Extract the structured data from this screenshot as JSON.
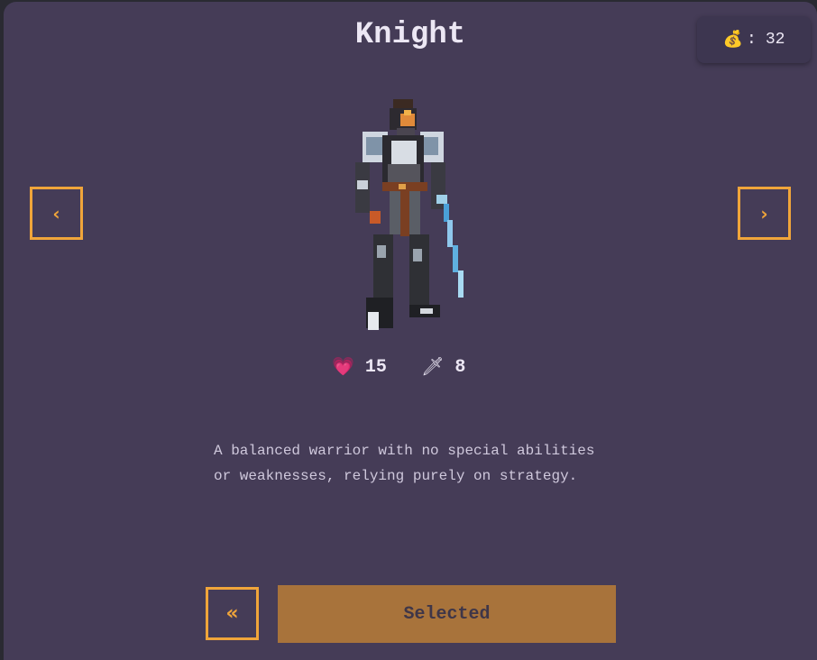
{
  "character": {
    "name": "Knight",
    "health": "15",
    "attack": "8",
    "description": "A balanced warrior with no special abilities or weaknesses, relying purely on strategy."
  },
  "wallet": {
    "icon": "money-bag-icon",
    "separator": ":",
    "coins": "32"
  },
  "icons": {
    "health": "heart-icon",
    "attack": "dagger-icon",
    "prev": "chevron-left-icon",
    "next": "chevron-right-icon",
    "back": "double-chevron-left-icon"
  },
  "glyphs": {
    "prev": "‹",
    "next": "›",
    "back": "«",
    "heart": "💗",
    "dagger": "🗡",
    "bag": "💰"
  },
  "actions": {
    "select_label": "Selected"
  },
  "colors": {
    "background": "#453c57",
    "accent": "#f0a53a",
    "selected_button": "#a8733b"
  }
}
